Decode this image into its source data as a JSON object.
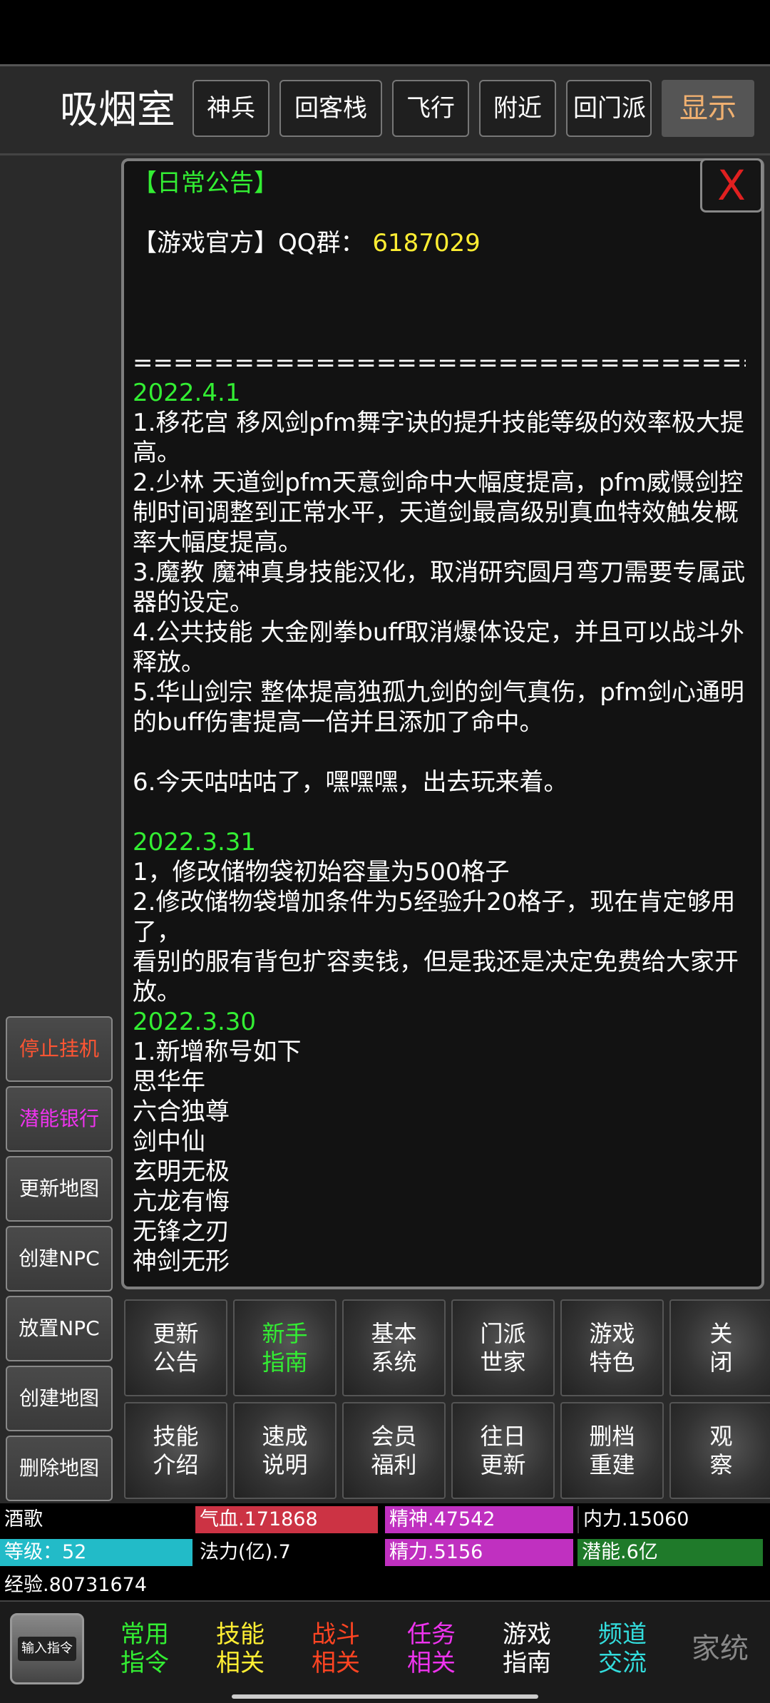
{
  "header": {
    "room_title": "吸烟室",
    "buttons": [
      "神兵",
      "回客栈",
      "飞行",
      "附近",
      "回门派"
    ],
    "show_label": "显示"
  },
  "left_buttons": [
    {
      "label": "停止挂机",
      "color": "#ff5533"
    },
    {
      "label": "潜能银行",
      "color": "#ee33ee"
    },
    {
      "label": "更新地图",
      "color": "#ffffff"
    },
    {
      "label": "创建NPC",
      "color": "#ffffff"
    },
    {
      "label": "放置NPC",
      "color": "#ffffff"
    },
    {
      "label": "创建地图",
      "color": "#ffffff"
    },
    {
      "label": "删除地图",
      "color": "#ffffff"
    }
  ],
  "notice": {
    "close_label": "X",
    "heading": "【日常公告】",
    "qq_label": "【游戏官方】QQ群：",
    "qq_number": "6187029",
    "divider": "========================================",
    "sections": [
      {
        "date": "2022.4.1",
        "lines": [
          "1.移花宫 移风剑pfm舞字诀的提升技能等级的效率极大提高。",
          "2.少林 天道剑pfm天意剑命中大幅度提高，pfm威慑剑控制时间调整到正常水平，天道剑最高级别真血特效触发概率大幅度提高。",
          "3.魔教 魔神真身技能汉化，取消研究圆月弯刀需要专属武器的设定。",
          "4.公共技能 大金刚拳buff取消爆体设定，并且可以战斗外释放。",
          "5.华山剑宗 整体提高独孤九剑的剑气真伤，pfm剑心通明的buff伤害提高一倍并且添加了命中。",
          "",
          "6.今天咕咕咕了，嘿嘿嘿，出去玩来着。",
          ""
        ]
      },
      {
        "date": "2022.3.31",
        "lines": [
          "1，修改储物袋初始容量为500格子",
          "2.修改储物袋增加条件为5经验升20格子，现在肯定够用了，",
          "看别的服有背包扩容卖钱，但是我还是决定免费给大家开放。"
        ]
      },
      {
        "date": "2022.3.30",
        "lines": [
          "1.新增称号如下",
          "思华年",
          "六合独尊",
          "剑中仙",
          "玄明无极",
          "亢龙有悔",
          "无锋之刃",
          "神剑无形"
        ]
      }
    ]
  },
  "menu": [
    {
      "label": "更新\n公告",
      "color": "#ffffff"
    },
    {
      "label": "新手\n指南",
      "color": "#33ee33"
    },
    {
      "label": "基本\n系统",
      "color": "#ffffff"
    },
    {
      "label": "门派\n世家",
      "color": "#ffffff"
    },
    {
      "label": "游戏\n特色",
      "color": "#ffffff"
    },
    {
      "label": "关\n闭",
      "color": "#ffffff"
    },
    {
      "label": "技能\n介绍",
      "color": "#ffffff"
    },
    {
      "label": "速成\n说明",
      "color": "#ffffff"
    },
    {
      "label": "会员\n福利",
      "color": "#ffffff"
    },
    {
      "label": "往日\n更新",
      "color": "#ffffff"
    },
    {
      "label": "删档\n重建",
      "color": "#ffffff"
    },
    {
      "label": "观\n察",
      "color": "#ffffff"
    }
  ],
  "stats": {
    "name": "酒歌",
    "hp": "气血.171868",
    "spirit": "精神.47542",
    "neili": "内力.15060",
    "level": "等级：52",
    "fali": "法力(亿).7",
    "jingli": "精力.5156",
    "potential": "潜能.6亿",
    "exp": "经验.80731674"
  },
  "bottom_nav": [
    {
      "label": "常用\n指令",
      "color": "#33ee33"
    },
    {
      "label": "技能\n相关",
      "color": "#ffee33"
    },
    {
      "label": "战斗\n相关",
      "color": "#ff4422"
    },
    {
      "label": "任务\n相关",
      "color": "#ee33ee"
    },
    {
      "label": "游戏\n指南",
      "color": "#ffffff"
    },
    {
      "label": "频道\n交流",
      "color": "#33dddd"
    }
  ],
  "input_label": "输入指令",
  "watermark": "家统"
}
